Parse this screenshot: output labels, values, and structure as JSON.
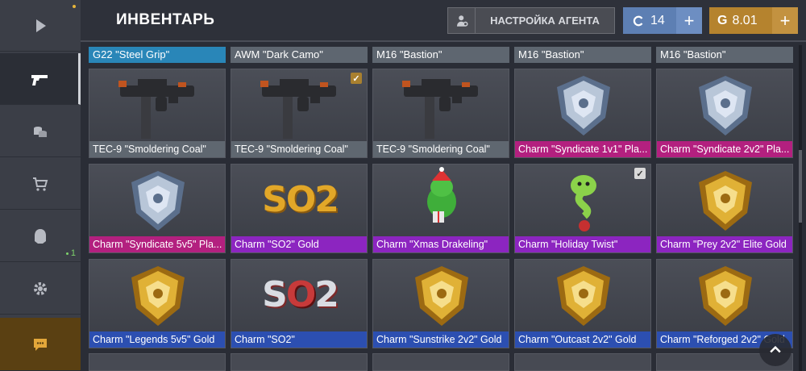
{
  "header": {
    "title": "ИНВЕНТАРЬ",
    "agent_button_label": "НАСТРОЙКА АГЕНТА",
    "currency_c": {
      "symbol": "C",
      "amount": "14"
    },
    "currency_g": {
      "symbol": "G",
      "amount": "8.01"
    },
    "plus": "+"
  },
  "sidebar": {
    "items": [
      {
        "icon": "play-icon"
      },
      {
        "icon": "gun-icon",
        "active": true
      },
      {
        "icon": "coins-icon"
      },
      {
        "icon": "cart-icon"
      },
      {
        "icon": "agent-icon",
        "badge": "1"
      },
      {
        "icon": "gear-icon"
      },
      {
        "icon": "chat-icon"
      }
    ]
  },
  "strip": [
    {
      "label": "G22 \"Steel Grip\"",
      "color": "blue"
    },
    {
      "label": "AWM \"Dark Camo\"",
      "color": "gray"
    },
    {
      "label": "M16 \"Bastion\"",
      "color": "gray"
    },
    {
      "label": "M16 \"Bastion\"",
      "color": "gray"
    },
    {
      "label": "M16 \"Bastion\"",
      "color": "gray"
    }
  ],
  "cards": [
    {
      "label": "TEC-9 \"Smoldering Coal\"",
      "color": "gray",
      "art": "tec9"
    },
    {
      "label": "TEC-9 \"Smoldering Coal\"",
      "color": "gray",
      "art": "tec9",
      "check": "gold"
    },
    {
      "label": "TEC-9 \"Smoldering Coal\"",
      "color": "gray",
      "art": "tec9"
    },
    {
      "label": "Charm \"Syndicate 1v1\" Pla...",
      "color": "pink",
      "art": "badge-silver"
    },
    {
      "label": "Charm \"Syndicate 2v2\" Pla...",
      "color": "pink",
      "art": "badge-silver"
    },
    {
      "label": "Charm \"Syndicate 5v5\" Pla...",
      "color": "pink",
      "art": "badge-silver"
    },
    {
      "label": "Charm \"SO2\" Gold",
      "color": "purple",
      "art": "so2-gold"
    },
    {
      "label": "Charm \"Xmas Drakeling\"",
      "color": "purple",
      "art": "drake"
    },
    {
      "label": "Charm \"Holiday Twist\"",
      "color": "purple",
      "art": "snake",
      "check": "white"
    },
    {
      "label": "Charm \"Prey 2v2\" Elite Gold",
      "color": "purple",
      "art": "badge-gold"
    },
    {
      "label": "Charm \"Legends 5v5\" Gold",
      "color": "blue",
      "art": "badge-gold"
    },
    {
      "label": "Charm \"SO2\"",
      "color": "blue",
      "art": "so2-silver"
    },
    {
      "label": "Charm \"Sunstrike 2v2\" Gold",
      "color": "blue",
      "art": "badge-gold"
    },
    {
      "label": "Charm \"Outcast 2v2\" Gold",
      "color": "blue",
      "art": "badge-gold"
    },
    {
      "label": "Charm \"Reforged 2v2\" Gold",
      "color": "blue",
      "art": "badge-gold"
    }
  ],
  "so2_text": {
    "s": "S",
    "o": "O",
    "two": "2"
  },
  "colors": {
    "gray": "#5f6770",
    "pink": "#b3207f",
    "purple": "#8c25c0",
    "blue": "#2c4fb1",
    "gold_currency": "#b5832e",
    "silver_currency": "#5d7fb3"
  }
}
